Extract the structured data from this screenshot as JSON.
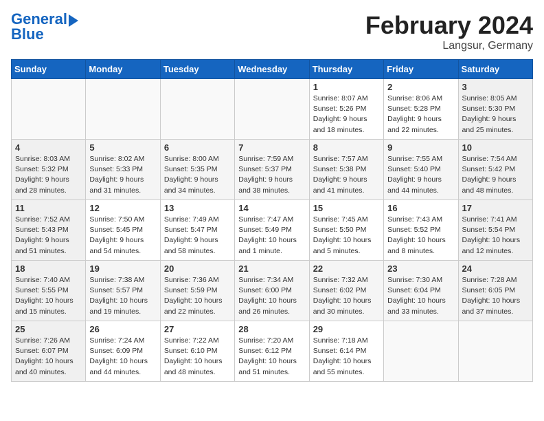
{
  "header": {
    "logo_line1": "General",
    "logo_line2": "Blue",
    "month": "February 2024",
    "location": "Langsur, Germany"
  },
  "days_of_week": [
    "Sunday",
    "Monday",
    "Tuesday",
    "Wednesday",
    "Thursday",
    "Friday",
    "Saturday"
  ],
  "weeks": [
    [
      {
        "day": "",
        "info": ""
      },
      {
        "day": "",
        "info": ""
      },
      {
        "day": "",
        "info": ""
      },
      {
        "day": "",
        "info": ""
      },
      {
        "day": "1",
        "info": "Sunrise: 8:07 AM\nSunset: 5:26 PM\nDaylight: 9 hours\nand 18 minutes."
      },
      {
        "day": "2",
        "info": "Sunrise: 8:06 AM\nSunset: 5:28 PM\nDaylight: 9 hours\nand 22 minutes."
      },
      {
        "day": "3",
        "info": "Sunrise: 8:05 AM\nSunset: 5:30 PM\nDaylight: 9 hours\nand 25 minutes."
      }
    ],
    [
      {
        "day": "4",
        "info": "Sunrise: 8:03 AM\nSunset: 5:32 PM\nDaylight: 9 hours\nand 28 minutes."
      },
      {
        "day": "5",
        "info": "Sunrise: 8:02 AM\nSunset: 5:33 PM\nDaylight: 9 hours\nand 31 minutes."
      },
      {
        "day": "6",
        "info": "Sunrise: 8:00 AM\nSunset: 5:35 PM\nDaylight: 9 hours\nand 34 minutes."
      },
      {
        "day": "7",
        "info": "Sunrise: 7:59 AM\nSunset: 5:37 PM\nDaylight: 9 hours\nand 38 minutes."
      },
      {
        "day": "8",
        "info": "Sunrise: 7:57 AM\nSunset: 5:38 PM\nDaylight: 9 hours\nand 41 minutes."
      },
      {
        "day": "9",
        "info": "Sunrise: 7:55 AM\nSunset: 5:40 PM\nDaylight: 9 hours\nand 44 minutes."
      },
      {
        "day": "10",
        "info": "Sunrise: 7:54 AM\nSunset: 5:42 PM\nDaylight: 9 hours\nand 48 minutes."
      }
    ],
    [
      {
        "day": "11",
        "info": "Sunrise: 7:52 AM\nSunset: 5:43 PM\nDaylight: 9 hours\nand 51 minutes."
      },
      {
        "day": "12",
        "info": "Sunrise: 7:50 AM\nSunset: 5:45 PM\nDaylight: 9 hours\nand 54 minutes."
      },
      {
        "day": "13",
        "info": "Sunrise: 7:49 AM\nSunset: 5:47 PM\nDaylight: 9 hours\nand 58 minutes."
      },
      {
        "day": "14",
        "info": "Sunrise: 7:47 AM\nSunset: 5:49 PM\nDaylight: 10 hours\nand 1 minute."
      },
      {
        "day": "15",
        "info": "Sunrise: 7:45 AM\nSunset: 5:50 PM\nDaylight: 10 hours\nand 5 minutes."
      },
      {
        "day": "16",
        "info": "Sunrise: 7:43 AM\nSunset: 5:52 PM\nDaylight: 10 hours\nand 8 minutes."
      },
      {
        "day": "17",
        "info": "Sunrise: 7:41 AM\nSunset: 5:54 PM\nDaylight: 10 hours\nand 12 minutes."
      }
    ],
    [
      {
        "day": "18",
        "info": "Sunrise: 7:40 AM\nSunset: 5:55 PM\nDaylight: 10 hours\nand 15 minutes."
      },
      {
        "day": "19",
        "info": "Sunrise: 7:38 AM\nSunset: 5:57 PM\nDaylight: 10 hours\nand 19 minutes."
      },
      {
        "day": "20",
        "info": "Sunrise: 7:36 AM\nSunset: 5:59 PM\nDaylight: 10 hours\nand 22 minutes."
      },
      {
        "day": "21",
        "info": "Sunrise: 7:34 AM\nSunset: 6:00 PM\nDaylight: 10 hours\nand 26 minutes."
      },
      {
        "day": "22",
        "info": "Sunrise: 7:32 AM\nSunset: 6:02 PM\nDaylight: 10 hours\nand 30 minutes."
      },
      {
        "day": "23",
        "info": "Sunrise: 7:30 AM\nSunset: 6:04 PM\nDaylight: 10 hours\nand 33 minutes."
      },
      {
        "day": "24",
        "info": "Sunrise: 7:28 AM\nSunset: 6:05 PM\nDaylight: 10 hours\nand 37 minutes."
      }
    ],
    [
      {
        "day": "25",
        "info": "Sunrise: 7:26 AM\nSunset: 6:07 PM\nDaylight: 10 hours\nand 40 minutes."
      },
      {
        "day": "26",
        "info": "Sunrise: 7:24 AM\nSunset: 6:09 PM\nDaylight: 10 hours\nand 44 minutes."
      },
      {
        "day": "27",
        "info": "Sunrise: 7:22 AM\nSunset: 6:10 PM\nDaylight: 10 hours\nand 48 minutes."
      },
      {
        "day": "28",
        "info": "Sunrise: 7:20 AM\nSunset: 6:12 PM\nDaylight: 10 hours\nand 51 minutes."
      },
      {
        "day": "29",
        "info": "Sunrise: 7:18 AM\nSunset: 6:14 PM\nDaylight: 10 hours\nand 55 minutes."
      },
      {
        "day": "",
        "info": ""
      },
      {
        "day": "",
        "info": ""
      }
    ]
  ]
}
